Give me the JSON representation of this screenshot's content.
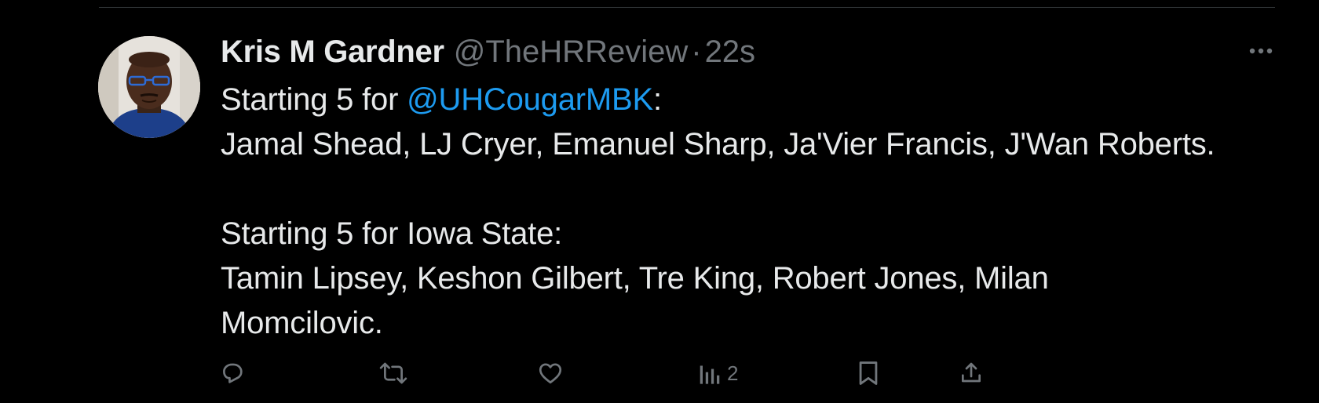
{
  "tweet": {
    "author_name": "Kris M Gardner",
    "handle": "@TheHRReview",
    "separator": "·",
    "time": "22s",
    "body": {
      "line1_prefix": "Starting 5 for ",
      "line1_mention": "@UHCougarMBK",
      "line1_suffix": ":",
      "line2": "Jamal Shead, LJ Cryer, Emanuel Sharp, Ja'Vier Francis, J'Wan Roberts.",
      "line3": "",
      "line4": "Starting 5 for Iowa State:",
      "line5": "Tamin Lipsey, Keshon Gilbert, Tre King, Robert Jones, Milan",
      "line6": "Momcilovic."
    },
    "actions": {
      "reply_icon": "reply-icon",
      "retweet_icon": "retweet-icon",
      "like_icon": "heart-icon",
      "views_icon": "views-icon",
      "views_count": "2",
      "bookmark_icon": "bookmark-icon",
      "share_icon": "share-icon"
    }
  },
  "colors": {
    "background": "#000000",
    "text_primary": "#e7e9ea",
    "text_secondary": "#71767b",
    "link": "#1d9bf0",
    "divider": "#2f3336"
  }
}
